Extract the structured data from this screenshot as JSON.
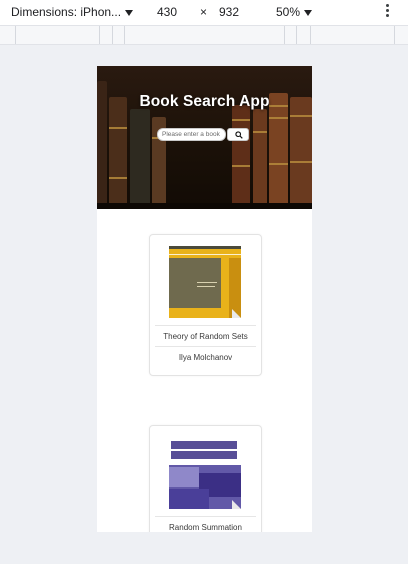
{
  "devtools": {
    "dimensions_label": "Dimensions: iPhon...",
    "width": "430",
    "times": "×",
    "height": "932",
    "zoom": "50%",
    "icons": [
      "chevron-down-icon",
      "more-vert-icon"
    ]
  },
  "app": {
    "title": "Book Search App",
    "search": {
      "placeholder": "Please enter a book",
      "button_icon": "search-icon"
    }
  },
  "books": [
    {
      "title": "Theory of Random Sets",
      "author": "Ilya Molchanov"
    },
    {
      "title": "Random Summation"
    }
  ],
  "colors": {
    "cover1_bg": "#e9b21a",
    "cover1_band": "#6f6a4e",
    "cover2_bg": "#6259a8",
    "cover2_band": "#3b2f85"
  }
}
